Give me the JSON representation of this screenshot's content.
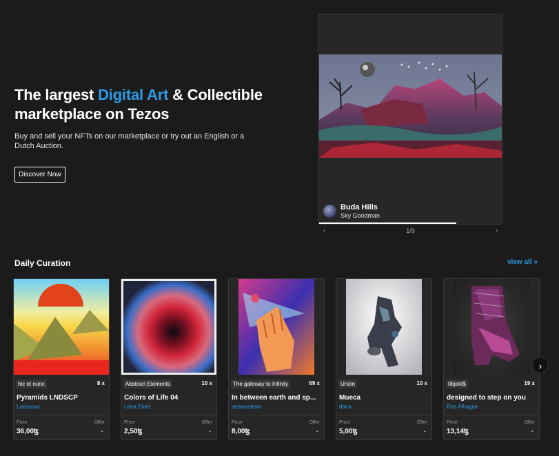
{
  "hero": {
    "title_pre": "The largest ",
    "title_accent": "Digital Art",
    "title_post": " & Collectible marketplace on Tezos",
    "subtitle": "Buy and sell your NFTs on our marketplace or try out an English or a Dutch Auction.",
    "cta_label": "Discover Now"
  },
  "featured": {
    "title": "Buda Hills",
    "author": "Sky Goodman",
    "counter": "1/9",
    "progress": 0.75,
    "prev_icon": "‹",
    "next_icon": "›"
  },
  "curation": {
    "title": "Daily Curation",
    "view_all": "view all »",
    "price_label": "Price",
    "offer_label": "Offer",
    "next_icon": "›",
    "cards": [
      {
        "collection": "hic et nunc",
        "editions": "8 x",
        "name": "Pyramids LNDSCP",
        "artist": "Lucasoxx",
        "price": "36,00ꜩ",
        "offer": "-"
      },
      {
        "collection": "Abstract Elements",
        "editions": "10 x",
        "name": "Colors of Life 04",
        "artist": "Lena Ekert",
        "price": "2,50ꜩ",
        "offer": "-"
      },
      {
        "collection": "The gateway to Infinity",
        "editions": "69 x",
        "name": "In between earth and sp...",
        "artist": "sebacestaro",
        "price": "8,00ꜩ",
        "offer": "-"
      },
      {
        "collection": "Unión",
        "editions": "10 x",
        "name": "Mueca",
        "artist": "daira",
        "price": "5,00ꜩ",
        "offer": "-"
      },
      {
        "collection": "0bjekt$",
        "editions": "19 x",
        "name": "designed to step on you",
        "artist": "Ras Alhague",
        "price": "13,14ꜩ",
        "offer": "-"
      }
    ]
  }
}
